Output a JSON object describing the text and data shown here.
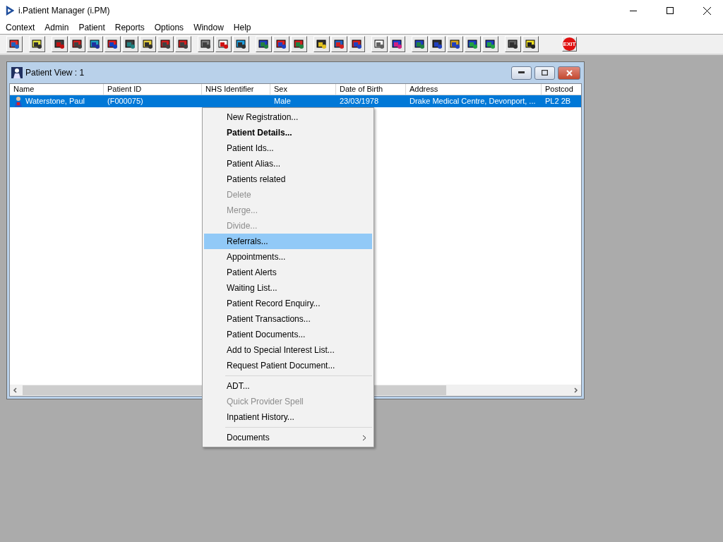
{
  "window": {
    "title": "i.Patient Manager (i.PM)"
  },
  "menu_bar": [
    {
      "label": "Context"
    },
    {
      "label": "Admin"
    },
    {
      "label": "Patient"
    },
    {
      "label": "Reports"
    },
    {
      "label": "Options"
    },
    {
      "label": "Window"
    },
    {
      "label": "Help"
    }
  ],
  "toolbar": {
    "exit_button": {
      "label": "EXIT"
    }
  },
  "child_window": {
    "title": "Patient View : 1",
    "table": {
      "columns": [
        "Name",
        "Patient ID",
        "NHS Identifier",
        "Sex",
        "Date of Birth",
        "Address",
        "Postcod"
      ],
      "rows": [
        {
          "selected": true,
          "cells": [
            "Waterstone, Paul",
            "(F000075)",
            "",
            "Male",
            "23/03/1978",
            "Drake Medical Centre, Devonport, ...",
            "PL2 2B"
          ]
        }
      ]
    }
  },
  "context_menu": [
    {
      "kind": "item",
      "label": "New Registration...",
      "bold": false,
      "disabled": false,
      "selected": false
    },
    {
      "kind": "item",
      "label": "Patient Details...",
      "bold": true,
      "disabled": false,
      "selected": false
    },
    {
      "kind": "item",
      "label": "Patient Ids...",
      "bold": false,
      "disabled": false,
      "selected": false
    },
    {
      "kind": "item",
      "label": "Patient Alias...",
      "bold": false,
      "disabled": false,
      "selected": false
    },
    {
      "kind": "item",
      "label": "Patients related",
      "bold": false,
      "disabled": false,
      "selected": false
    },
    {
      "kind": "item",
      "label": "Delete",
      "bold": false,
      "disabled": true,
      "selected": false
    },
    {
      "kind": "item",
      "label": "Merge...",
      "bold": false,
      "disabled": true,
      "selected": false
    },
    {
      "kind": "item",
      "label": "Divide...",
      "bold": false,
      "disabled": true,
      "selected": false
    },
    {
      "kind": "item",
      "label": "Referrals...",
      "bold": false,
      "disabled": false,
      "selected": true
    },
    {
      "kind": "item",
      "label": "Appointments...",
      "bold": false,
      "disabled": false,
      "selected": false
    },
    {
      "kind": "item",
      "label": "Patient Alerts",
      "bold": false,
      "disabled": false,
      "selected": false
    },
    {
      "kind": "item",
      "label": "Waiting List...",
      "bold": false,
      "disabled": false,
      "selected": false
    },
    {
      "kind": "item",
      "label": "Patient Record Enquiry...",
      "bold": false,
      "disabled": false,
      "selected": false
    },
    {
      "kind": "item",
      "label": "Patient Transactions...",
      "bold": false,
      "disabled": false,
      "selected": false
    },
    {
      "kind": "item",
      "label": "Patient Documents...",
      "bold": false,
      "disabled": false,
      "selected": false
    },
    {
      "kind": "item",
      "label": "Add to Special Interest List...",
      "bold": false,
      "disabled": false,
      "selected": false
    },
    {
      "kind": "item",
      "label": "Request Patient Document...",
      "bold": false,
      "disabled": false,
      "selected": false
    },
    {
      "kind": "separator"
    },
    {
      "kind": "item",
      "label": "ADT...",
      "bold": false,
      "disabled": false,
      "selected": false
    },
    {
      "kind": "item",
      "label": "Quick Provider Spell",
      "bold": false,
      "disabled": true,
      "selected": false
    },
    {
      "kind": "item",
      "label": "Inpatient History...",
      "bold": false,
      "disabled": false,
      "selected": false
    },
    {
      "kind": "separator"
    },
    {
      "kind": "submenu",
      "label": "Documents",
      "bold": false,
      "disabled": false,
      "selected": false
    }
  ]
}
